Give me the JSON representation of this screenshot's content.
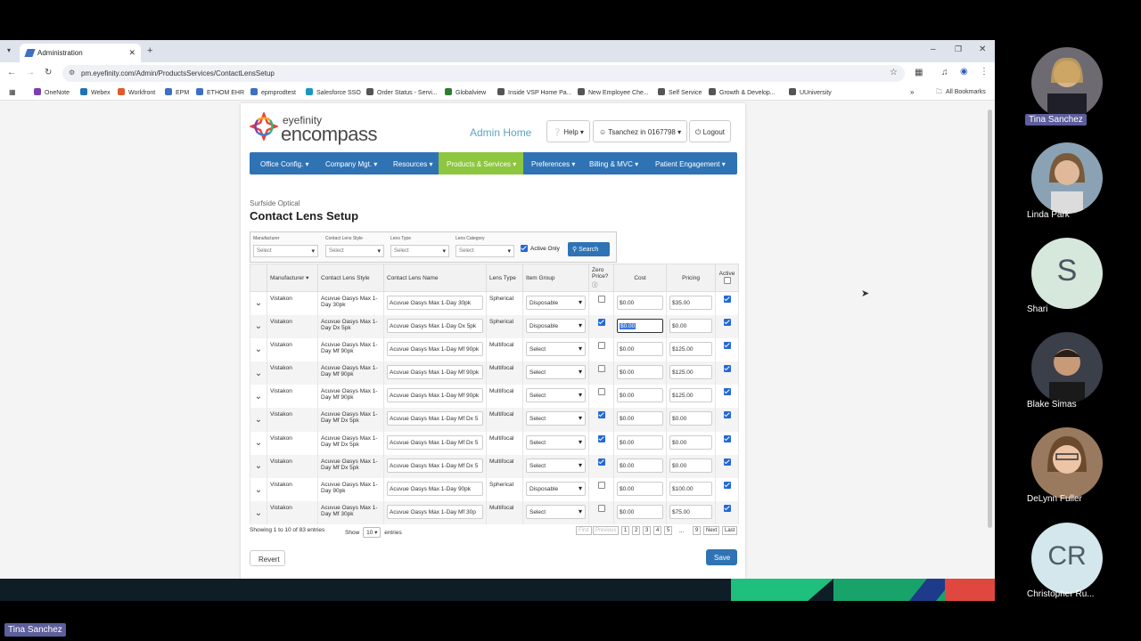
{
  "browser": {
    "tab_title": "Administration",
    "url": "pm.eyefinity.com/Admin/ProductsServices/ContactLensSetup",
    "all_bookmarks": "All Bookmarks"
  },
  "bookmarks": [
    {
      "label": "OneNote",
      "color": "#7a3fb1"
    },
    {
      "label": "Webex",
      "color": "#1f73b7"
    },
    {
      "label": "Workfront",
      "color": "#e05a2a"
    },
    {
      "label": "EPM",
      "color": "#3d6fc4"
    },
    {
      "label": "ETHOM EHR",
      "color": "#3d6fc4"
    },
    {
      "label": "epmprodtest",
      "color": "#3d6fc4"
    },
    {
      "label": "Salesforce SSO",
      "color": "#1798c1"
    },
    {
      "label": "Order Status - Servi...",
      "color": "#555555"
    },
    {
      "label": "Globalview",
      "color": "#2e7d32"
    },
    {
      "label": "Inside VSP Home Pa...",
      "color": "#555555"
    },
    {
      "label": "New Employee Che...",
      "color": "#555555"
    },
    {
      "label": "Self Service",
      "color": "#555555"
    },
    {
      "label": "Growth & Develop...",
      "color": "#555555"
    },
    {
      "label": "UUniversity",
      "color": "#555555"
    }
  ],
  "app": {
    "logo_top": "eyefinity",
    "logo_bottom": "encompass",
    "admin_home": "Admin Home",
    "help": "Help",
    "user": "Tsanchez in 0167798",
    "logout": "Logout"
  },
  "nav": [
    {
      "label": "Office Config."
    },
    {
      "label": "Company Mgt."
    },
    {
      "label": "Resources"
    },
    {
      "label": "Products & Services"
    },
    {
      "label": "Preferences"
    },
    {
      "label": "Billing & MVC"
    },
    {
      "label": "Patient Engagement"
    }
  ],
  "page": {
    "office": "Surfside Optical",
    "title": "Contact Lens Setup"
  },
  "filters": {
    "manufacturer_label": "Manufacturer",
    "style_label": "Contact Lens Style",
    "type_label": "Lens Type",
    "category_label": "Lens Category",
    "placeholder": "Select",
    "active_only": "Active Only",
    "search": "Search"
  },
  "columns": {
    "manufacturer": "Manufacturer",
    "style": "Contact Lens Style",
    "name": "Contact Lens Name",
    "type": "Lens Type",
    "group": "Item Group",
    "zero": "Zero Price?",
    "cost": "Cost",
    "pricing": "Pricing",
    "active": "Active"
  },
  "rows": [
    {
      "manufacturer": "Vistakon",
      "style": "Acuvue Oasys Max 1-Day 30pk",
      "name": "Acuvue Oasys Max 1-Day 30pk",
      "type": "Spherical",
      "group": "Disposable",
      "zero": false,
      "cost": "$0.00",
      "price": "$35.00",
      "active": true
    },
    {
      "manufacturer": "Vistakon",
      "style": "Acuvue Oasys Max 1-Day Dx 5pk",
      "name": "Acuvue Oasys Max 1-Day Dx 5pk",
      "type": "Spherical",
      "group": "Disposable",
      "zero": true,
      "cost": "$0.00",
      "price": "$0.00",
      "active": true
    },
    {
      "manufacturer": "Vistakon",
      "style": "Acuvue Oasys Max 1-Day Mf 90pk",
      "name": "Acuvue Oasys Max 1-Day Mf 90pk",
      "type": "Multifocal",
      "group": "Select",
      "zero": false,
      "cost": "$0.00",
      "price": "$125.00",
      "active": true
    },
    {
      "manufacturer": "Vistakon",
      "style": "Acuvue Oasys Max 1-Day Mf 90pk",
      "name": "Acuvue Oasys Max 1-Day Mf 90pk",
      "type": "Multifocal",
      "group": "Select",
      "zero": false,
      "cost": "$0.00",
      "price": "$125.00",
      "active": true
    },
    {
      "manufacturer": "Vistakon",
      "style": "Acuvue Oasys Max 1-Day Mf 90pk",
      "name": "Acuvue Oasys Max 1-Day Mf 90pk",
      "type": "Multifocal",
      "group": "Select",
      "zero": false,
      "cost": "$0.00",
      "price": "$125.00",
      "active": true
    },
    {
      "manufacturer": "Vistakon",
      "style": "Acuvue Oasys Max 1-Day Mf Dx 5pk",
      "name": "Acuvue Oasys Max 1-Day Mf Dx 5",
      "type": "Multifocal",
      "group": "Select",
      "zero": true,
      "cost": "$0.00",
      "price": "$0.00",
      "active": true
    },
    {
      "manufacturer": "Vistakon",
      "style": "Acuvue Oasys Max 1-Day Mf Dx 5pk",
      "name": "Acuvue Oasys Max 1-Day Mf Dx 5",
      "type": "Multifocal",
      "group": "Select",
      "zero": true,
      "cost": "$0.00",
      "price": "$0.00",
      "active": true
    },
    {
      "manufacturer": "Vistakon",
      "style": "Acuvue Oasys Max 1-Day Mf Dx 5pk",
      "name": "Acuvue Oasys Max 1-Day Mf Dx 5",
      "type": "Multifocal",
      "group": "Select",
      "zero": true,
      "cost": "$0.00",
      "price": "$0.00",
      "active": true
    },
    {
      "manufacturer": "Vistakon",
      "style": "Acuvue Oasys Max 1-Day 90pk",
      "name": "Acuvue Oasys Max 1-Day 90pk",
      "type": "Spherical",
      "group": "Disposable",
      "zero": false,
      "cost": "$0.00",
      "price": "$100.00",
      "active": true
    },
    {
      "manufacturer": "Vistakon",
      "style": "Acuvue Oasys Max 1-Day Mf 30pk",
      "name": "Acuvue Oasys Max 1-Day Mf 30p",
      "type": "Multifocal",
      "group": "Select",
      "zero": false,
      "cost": "$0.00",
      "price": "$75.00",
      "active": true
    }
  ],
  "footer": {
    "showing": "Showing 1 to 10 of 83 entries",
    "show": "Show",
    "entries_value": "10",
    "entries": "entries",
    "first": "First",
    "previous": "Previous",
    "pages": [
      "1",
      "2",
      "3",
      "4",
      "5"
    ],
    "ellipsis": "...",
    "last_page": "9",
    "next": "Next",
    "last": "Last",
    "revert": "Revert",
    "save": "Save"
  },
  "participants": [
    {
      "name": "Tina Sanchez",
      "kind": "photo",
      "color": "#6d6a72",
      "speaking": true
    },
    {
      "name": "Linda Park",
      "kind": "photo",
      "color": "#8aa2b4"
    },
    {
      "name": "Shari",
      "kind": "letter",
      "letter": "S"
    },
    {
      "name": "Blake Simas",
      "kind": "photo",
      "color": "#3a3f4a"
    },
    {
      "name": "DeLynn Fuller",
      "kind": "photo",
      "color": "#9a7a5e"
    },
    {
      "name": "Christopher Ru...",
      "kind": "letter",
      "letter": "CR"
    }
  ],
  "self_name": "Tina Sanchez"
}
